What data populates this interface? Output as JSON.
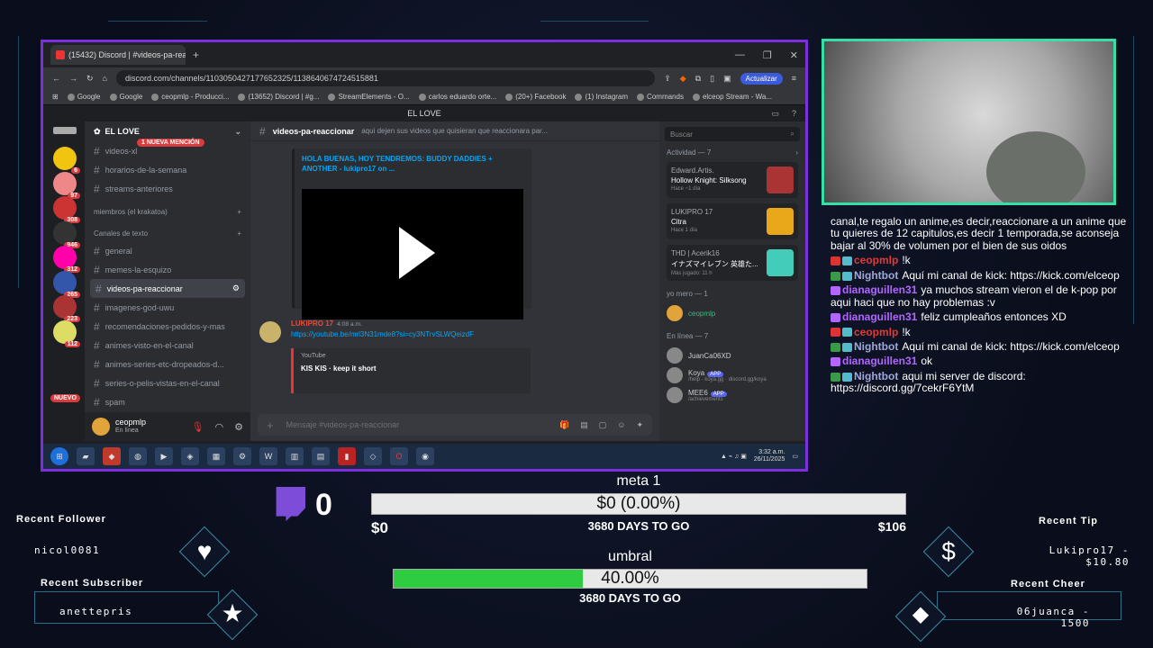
{
  "browser": {
    "tab_title": "(15432) Discord | #videos-pa-rea",
    "url": "discord.com/channels/1103050427177652325/1138640674724515881",
    "update_label": "Actualizar",
    "bookmarks": [
      "Google",
      "Google",
      "ceopmlp - Producci...",
      "(13652) Discord | #g...",
      "StreamElements - O...",
      "carlos eduardo orte...",
      "(20+) Facebook",
      "(1) Instagram",
      "Commands",
      "elceop Stream - Wa..."
    ]
  },
  "discord": {
    "top_title": "EL LOVE",
    "guild_name": "EL LOVE",
    "mention_badge": "1 NUEVA MENCIÓN",
    "server_badges": [
      "6",
      "97",
      "308",
      "946",
      "312",
      "265",
      "223",
      "112"
    ],
    "nuevo_badge": "NUEVO",
    "channels_top": [
      "videos-xl",
      "horarios-de-la-semana",
      "streams-anteriores"
    ],
    "category_members": "miembros (el krakatoa)",
    "category_text": "Canales de texto",
    "channels": [
      "general",
      "memes-la-esquizo",
      "videos-pa-reaccionar",
      "imagenes-god-uwu",
      "recomendaciones-pedidos-y-mas",
      "animes-visto-en-el-canal",
      "animes-series-etc-dropeados-d...",
      "series-o-pelis-vistas-en-el-canal",
      "spam"
    ],
    "user": {
      "name": "ceopmlp",
      "status": "En línea"
    },
    "channel_name": "videos-pa-reaccionar",
    "channel_topic": "aqui dejen sus videos que quisieran que reaccionara par...",
    "search_placeholder": "Buscar",
    "embed_title": "HOLA BUENAS, HOY TENDREMOS: BUDDY DADDIES + ANOTHER - lukipro17 on ...",
    "message": {
      "author": "LUKIPRO 17",
      "time": "4:08 a.m.",
      "link": "https://youtube.be/mrl3N31mde8?si=cy3NTrvSLWQeizdF",
      "yt_source": "YouTube",
      "yt_title": "KIS KIS · keep it short"
    },
    "composer_placeholder": "Mensaje #videos-pa-reaccionar",
    "activity_title": "Actividad — 7",
    "activity": [
      {
        "user": "Edward.Artis.",
        "title": "Hollow Knight: Silksong",
        "sub": "Hace ~1 día"
      },
      {
        "user": "LUKIPRO 17",
        "title": "Citra",
        "sub": "Hace 1 día"
      },
      {
        "user": "THD | Acerik16",
        "title": "イナズマイレブン 英雄た...",
        "sub": "Más jugado: 11 h"
      }
    ],
    "section_me": "yo mero — 1",
    "me_member": "ceopmlp",
    "section_online": "En línea — 7",
    "members": [
      {
        "name": "JuanCa06XD",
        "sub": ""
      },
      {
        "name": "Koya",
        "sub": "/help · koya.gg · discord.gg/koya",
        "app": "APP"
      },
      {
        "name": "MEE6",
        "sub": "/achievements",
        "app": "APP"
      }
    ]
  },
  "taskbar": {
    "time": "3:32 a.m.",
    "date": "26/11/2025"
  },
  "chat": [
    {
      "user": "",
      "text": "canal,te regalo un anime,es decir,reaccionare a un anime que tu quieres de 12 capitulos,es decir 1 temporada,se aconseja bajar al 30% de volumen por el bien de sus oidos",
      "color": "#ffffff"
    },
    {
      "user": "ceopmlp",
      "text": "!k",
      "color": "#e53935"
    },
    {
      "user": "Nightbot",
      "text": "Aquí mi canal de kick: https://kick.com/elceop",
      "color": "#9fa8da"
    },
    {
      "user": "dianaguillen31",
      "text": "ya muchos stream vieron el de k-pop por aqui haci que no hay problemas :v",
      "color": "#b266ff"
    },
    {
      "user": "dianaguillen31",
      "text": "feliz cumpleaños entonces XD",
      "color": "#b266ff"
    },
    {
      "user": "ceopmlp",
      "text": "!k",
      "color": "#e53935"
    },
    {
      "user": "Nightbot",
      "text": "Aquí mi canal de kick: https://kick.com/elceop",
      "color": "#9fa8da"
    },
    {
      "user": "dianaguillen31",
      "text": "ok",
      "color": "#b266ff"
    },
    {
      "user": "Nightbot",
      "text": "aqui mi server de discord: https://discord.gg/7cekrF6YtM",
      "color": "#9fa8da"
    }
  ],
  "overlay": {
    "sub_count": "0",
    "goal1": {
      "title": "meta 1",
      "bar_text": "$0 (0.00%)",
      "start": "$0",
      "end": "$106",
      "days": "3680 DAYS TO GO",
      "progress": 0
    },
    "goal2": {
      "title": "umbral",
      "bar_text": "40.00%",
      "days": "3680 DAYS TO GO",
      "progress": 0.4
    },
    "recent_follower_label": "Recent Follower",
    "recent_follower": "nicol0081",
    "recent_subscriber_label": "Recent Subscriber",
    "recent_subscriber": "anettepris",
    "recent_tip_label": "Recent Tip",
    "recent_tip": "Lukipro17 - $10.80",
    "recent_cheer_label": "Recent Cheer",
    "recent_cheer": "06juanca - 1500"
  },
  "colors": {
    "window_border": "#7b2fe0",
    "cam_border": "#33e0a6",
    "goal_fill": "#2ecc40",
    "twitch": "#7d4dd9"
  }
}
